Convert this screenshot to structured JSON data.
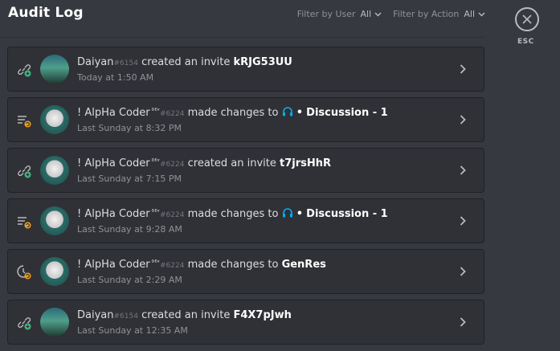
{
  "header": {
    "title": "Audit Log",
    "filter_user_label": "Filter by User",
    "filter_user_value": "All",
    "filter_action_label": "Filter by Action",
    "filter_action_value": "All"
  },
  "close": {
    "esc_label": "ESC",
    "icon": "close-icon"
  },
  "entries": [
    {
      "icon": "invite-create-icon",
      "avatar": "landscape",
      "user": "Daiyan",
      "disc": "#6154",
      "badge": "",
      "action": "created an invite",
      "target_icon": "",
      "target_prefix": "",
      "target": "kRJG53UU",
      "time": "Today at 1:50 AM"
    },
    {
      "icon": "channel-update-icon",
      "avatar": "robot",
      "user": "! AlpHa Coder",
      "disc": "#6224",
      "badge": "ᴰᴱᵛ",
      "action": "made changes to",
      "target_icon": "headphones-icon",
      "target_prefix": "•",
      "target": "Discussion - 1",
      "time": "Last Sunday at 8:32 PM"
    },
    {
      "icon": "invite-create-icon",
      "avatar": "robot",
      "user": "! AlpHa Coder",
      "disc": "#6224",
      "badge": "ᴰᴱᵛ",
      "action": "created an invite",
      "target_icon": "",
      "target_prefix": "",
      "target": "t7jrsHhR",
      "time": "Last Sunday at 7:15 PM"
    },
    {
      "icon": "channel-update-icon",
      "avatar": "robot",
      "user": "! AlpHa Coder",
      "disc": "#6224",
      "badge": "ᴰᴱᵛ",
      "action": "made changes to",
      "target_icon": "headphones-icon",
      "target_prefix": "•",
      "target": "Discussion - 1",
      "time": "Last Sunday at 9:28 AM"
    },
    {
      "icon": "server-update-icon",
      "avatar": "robot",
      "user": "! AlpHa Coder",
      "disc": "#6224",
      "badge": "ᴰᴱᵛ",
      "action": "made changes to",
      "target_icon": "",
      "target_prefix": "",
      "target": "GenRes",
      "time": "Last Sunday at 2:29 AM"
    },
    {
      "icon": "invite-create-icon",
      "avatar": "landscape",
      "user": "Daiyan",
      "disc": "#6154",
      "badge": "",
      "action": "created an invite",
      "target_icon": "",
      "target_prefix": "",
      "target": "F4X7pJwh",
      "time": "Last Sunday at 12:35 AM"
    }
  ]
}
